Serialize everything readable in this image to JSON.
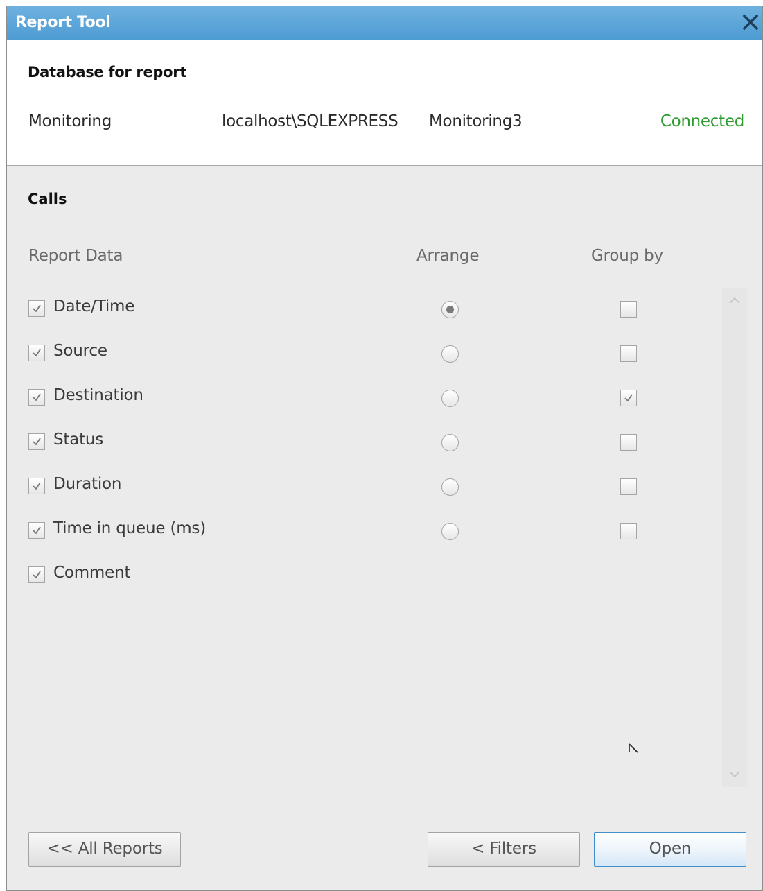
{
  "window": {
    "title": "Report Tool"
  },
  "database": {
    "section_title": "Database for report",
    "name": "Monitoring",
    "server": "localhost\\SQLEXPRESS",
    "database_name": "Monitoring3",
    "status": "Connected",
    "status_color": "#2e9b2e"
  },
  "calls": {
    "section_title": "Calls",
    "columns": {
      "report_data": "Report Data",
      "arrange": "Arrange",
      "group_by": "Group by"
    },
    "rows": [
      {
        "label": "Date/Time",
        "included": true,
        "arrange_selected": true,
        "group_by": false
      },
      {
        "label": "Source",
        "included": true,
        "arrange_selected": false,
        "group_by": false
      },
      {
        "label": "Destination",
        "included": true,
        "arrange_selected": false,
        "group_by": true
      },
      {
        "label": "Status",
        "included": true,
        "arrange_selected": false,
        "group_by": false
      },
      {
        "label": "Duration",
        "included": true,
        "arrange_selected": false,
        "group_by": false
      },
      {
        "label": "Time in queue (ms)",
        "included": true,
        "arrange_selected": false,
        "group_by": false
      },
      {
        "label": "Comment",
        "included": true
      }
    ]
  },
  "buttons": {
    "all_reports": "<< All Reports",
    "filters": "< Filters",
    "open": "Open"
  },
  "icons": {
    "close": "close-icon",
    "check": "check-icon",
    "scroll_up": "chevron-up-icon",
    "scroll_down": "chevron-down-icon",
    "cursor": "mouse-cursor-icon"
  },
  "colors": {
    "titlebar": "#5aa5da",
    "accent": "#3f8fcc"
  }
}
